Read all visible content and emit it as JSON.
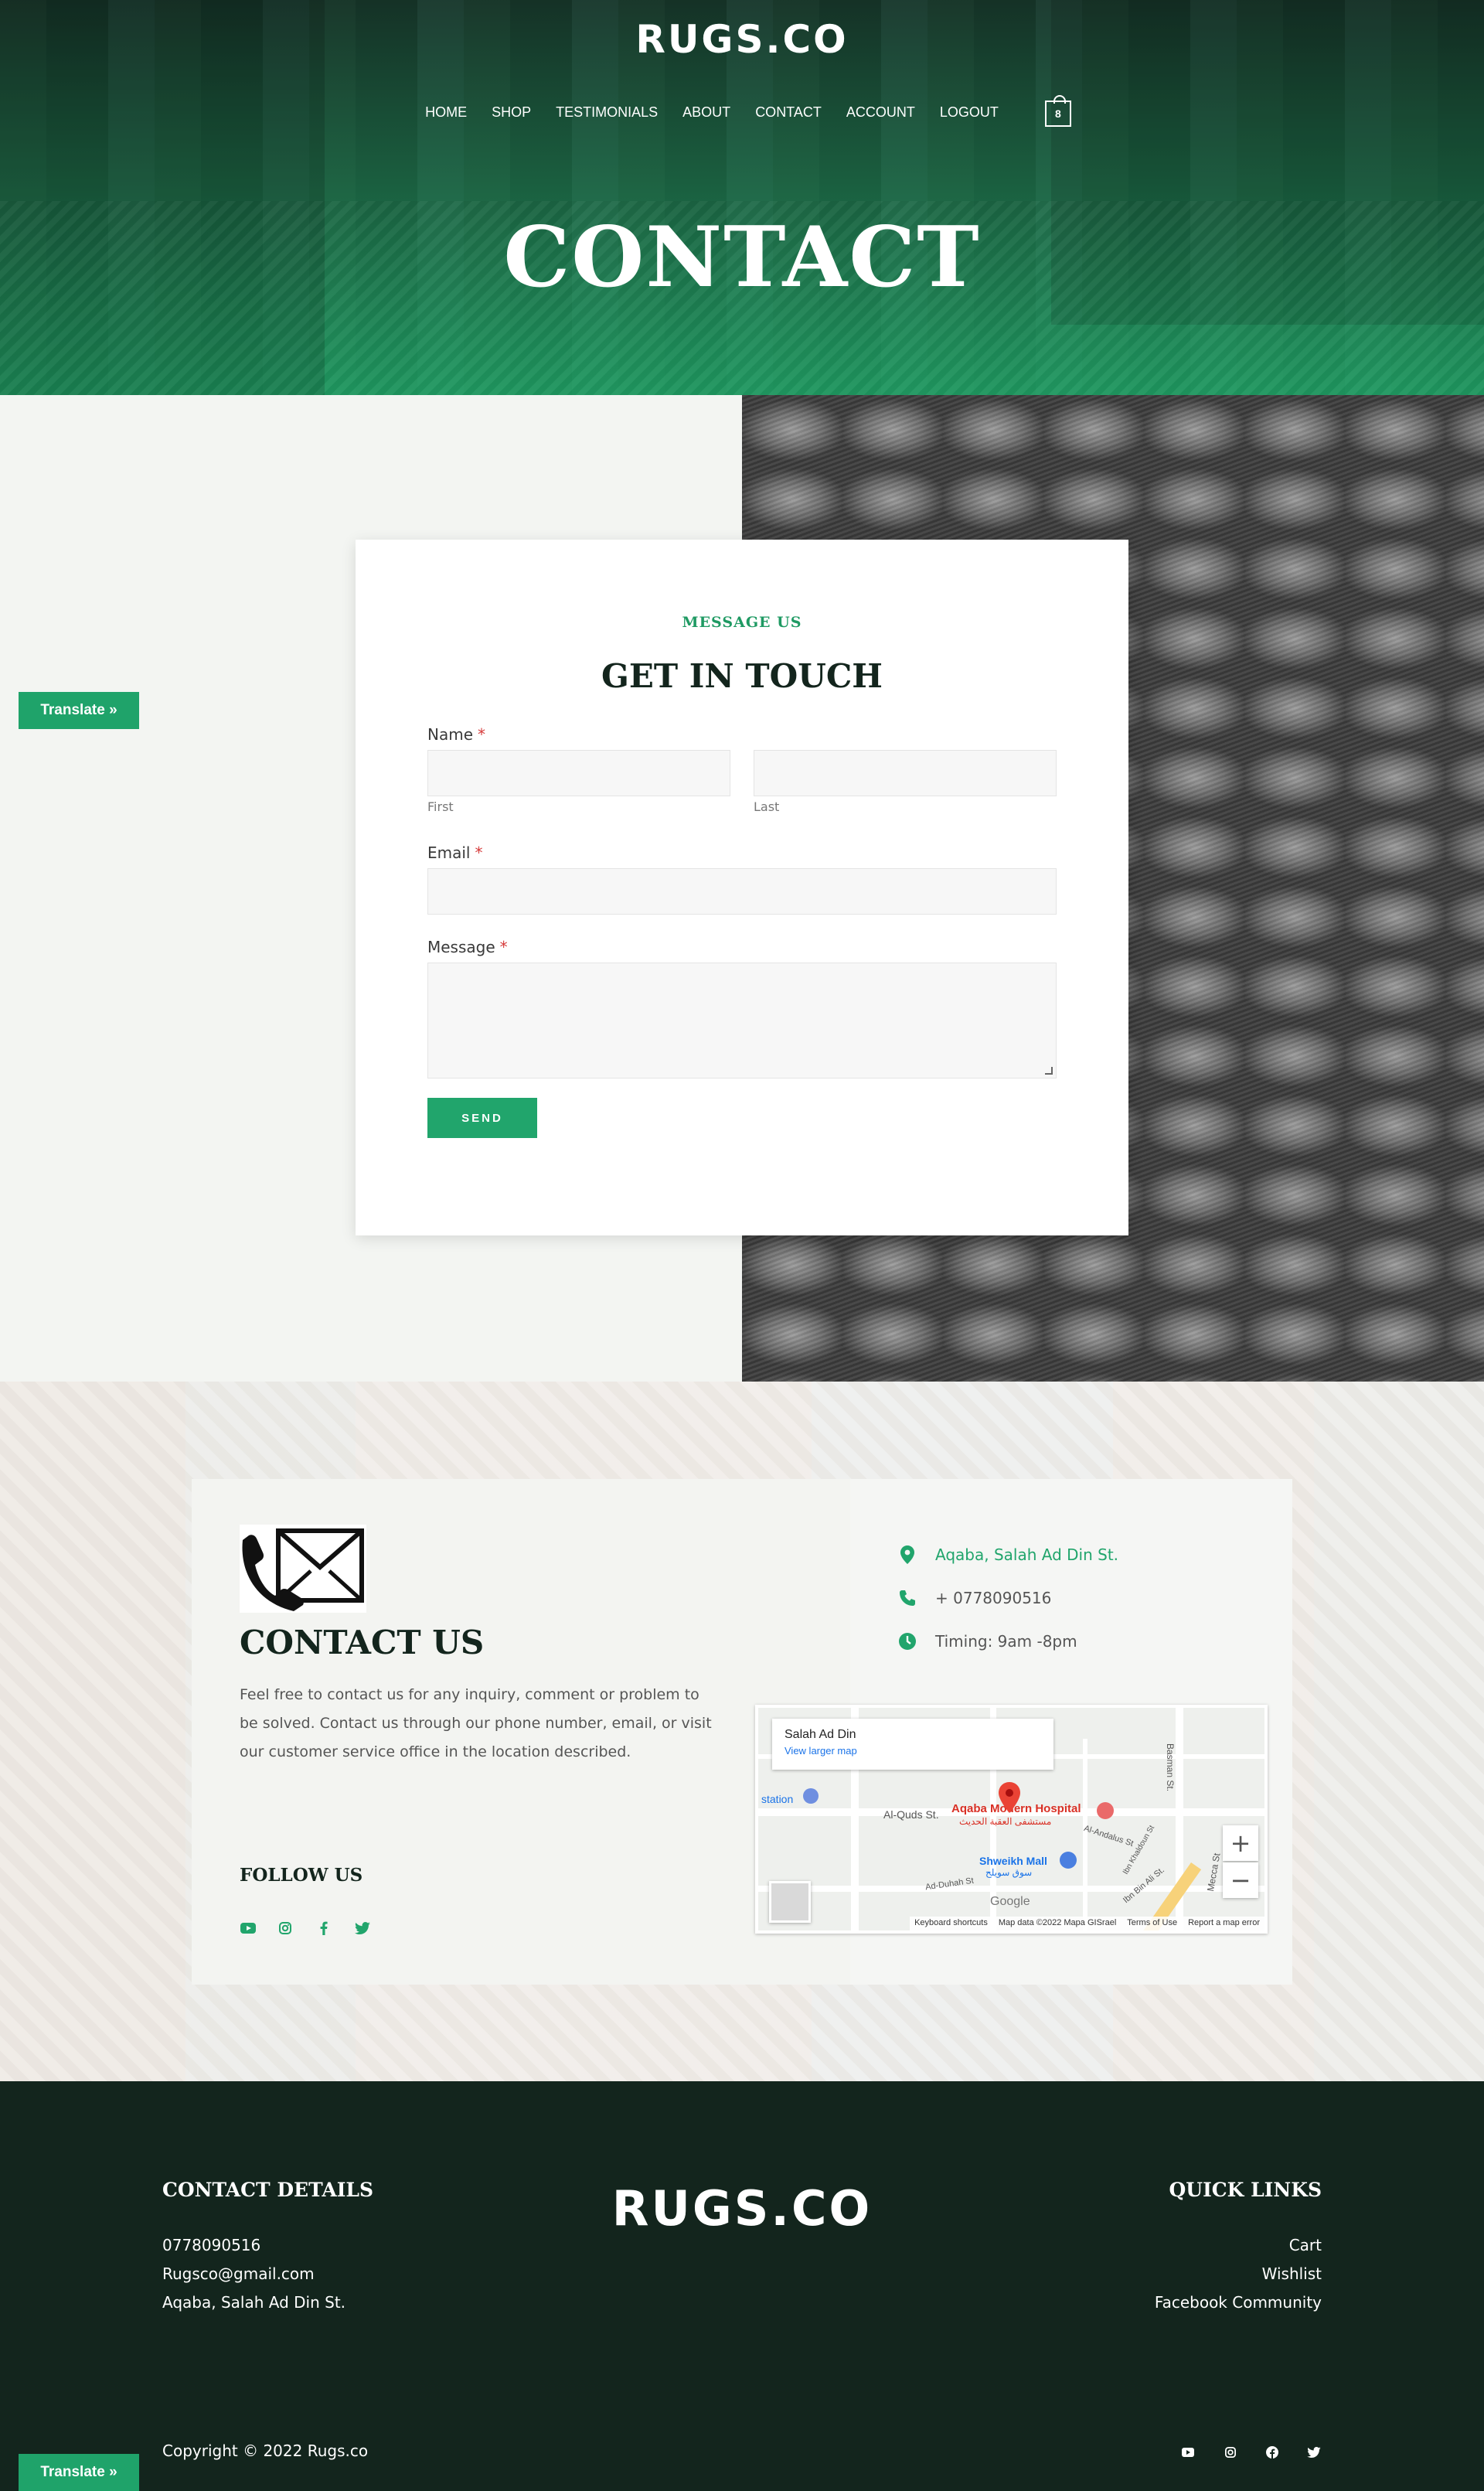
{
  "brand": {
    "logo_text": "RUGS.CO"
  },
  "nav": {
    "items": [
      {
        "label": "HOME"
      },
      {
        "label": "SHOP"
      },
      {
        "label": "TESTIMONIALS"
      },
      {
        "label": "ABOUT"
      },
      {
        "label": "CONTACT"
      },
      {
        "label": "ACCOUNT"
      },
      {
        "label": "LOGOUT"
      }
    ],
    "cart_count": "8"
  },
  "hero": {
    "title": "CONTACT"
  },
  "form": {
    "eyebrow": "MESSAGE US",
    "title": "GET IN TOUCH",
    "name_label": "Name",
    "required_mark": "*",
    "first_sub": "First",
    "last_sub": "Last",
    "first_value": "",
    "last_value": "",
    "email_label": "Email",
    "email_value": "",
    "message_label": "Message",
    "message_value": "",
    "send_label": "SEND"
  },
  "translate": {
    "label": "Translate »"
  },
  "contact_us": {
    "title": "CONTACT US",
    "text": "Feel free to contact us for any inquiry, comment or problem to be solved. Contact us through our phone number, email, or visit our customer service office in the location described.",
    "follow_title": "FOLLOW US",
    "address": "Aqaba, Salah Ad Din St.",
    "phone": "+ 0778090516",
    "timing": "Timing: 9am -8pm",
    "accent_color": "#21a56c"
  },
  "map": {
    "place_title": "Salah Ad Din",
    "place_link": "View larger map",
    "labels": {
      "station": "station",
      "al_quds": "Al-Quds St.",
      "hospital": "Aqaba Modern Hospital",
      "hospital_ar": "مستشفى العقبة الحديث",
      "mall": "Shweikh Mall",
      "mall_ar": "سوق سويلح",
      "al_andalus": "Al-Andalus St",
      "ad_duhah": "Ad-Duhah St",
      "basman": "Basman St.",
      "mecca": "Mecca St",
      "ibn_bin_ali": "Ibn Bin Ali St.",
      "ibn_khaldoun": "Ibn Khaldoun St"
    },
    "zoom_in": "+",
    "zoom_out": "−",
    "google": "Google",
    "footer": {
      "shortcuts": "Keyboard shortcuts",
      "data": "Map data ©2022 Mapa GISrael",
      "terms": "Terms of Use",
      "report": "Report a map error"
    }
  },
  "footer": {
    "contact_title": "CONTACT DETAILS",
    "phone": "0778090516",
    "email": "Rugsco@gmail.com",
    "address": "Aqaba, Salah Ad Din St.",
    "quick_title": "QUICK LINKS",
    "links": [
      {
        "label": "Cart"
      },
      {
        "label": "Wishlist"
      },
      {
        "label": "Facebook Community"
      }
    ],
    "copyright": "Copyright © 2022 Rugs.co",
    "bg_color": "#13251d"
  }
}
